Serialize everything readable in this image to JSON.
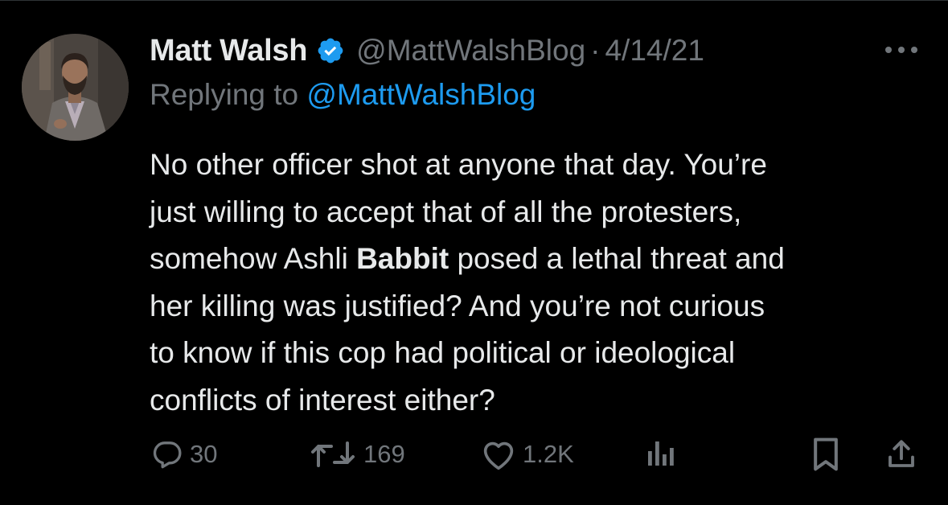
{
  "author": {
    "name": "Matt Walsh",
    "handle": "@MattWalshBlog",
    "separator": "·",
    "date": "4/14/21"
  },
  "reply": {
    "prefix": "Replying to ",
    "mention": "@MattWalshBlog"
  },
  "tweet": {
    "lines": [
      {
        "text": "No other officer shot at anyone that day. You’re"
      },
      {
        "text": "just willing to accept that of all the protesters,"
      },
      {
        "before": "somehow Ashli ",
        "bold": "Babbit",
        "after": " posed a lethal threat and"
      },
      {
        "text": "her killing was justified? And you’re not curious"
      },
      {
        "text": "to know if this cop had political or ideological"
      },
      {
        "text": "conflicts of interest either?"
      }
    ]
  },
  "actions": {
    "reply": {
      "icon": "reply-icon",
      "count": "30"
    },
    "retweet": {
      "icon": "retweet-icon",
      "count": "169"
    },
    "like": {
      "icon": "heart-icon",
      "count": "1.2K"
    },
    "views": {
      "icon": "views-icon"
    },
    "bookmark": {
      "icon": "bookmark-icon"
    },
    "share": {
      "icon": "share-icon"
    }
  },
  "colors": {
    "background": "#000000",
    "text_primary": "#e7e9ea",
    "text_secondary": "#71767b",
    "accent": "#1d9bf0"
  }
}
